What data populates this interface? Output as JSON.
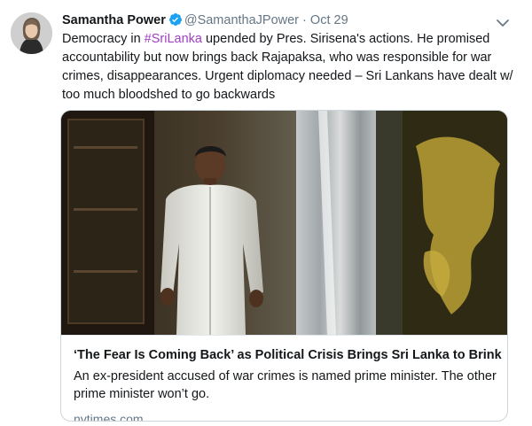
{
  "tweet": {
    "author_name": "Samantha Power",
    "author_handle": "@SamanthaJPower",
    "separator": "·",
    "time": "Oct 29",
    "text_before_hashtag": "Democracy in ",
    "hashtag": "#SriLanka",
    "text_after_hashtag": " upended by Pres. Sirisena's actions. He promised accountability but now brings back Rajapaksa, who was responsible for war crimes, disappearances. Urgent diplomacy needed – Sri Lankans have dealt w/ too much bloodshed to go backwards"
  },
  "card": {
    "title": "‘The Fear Is Coming Back’ as Political Crisis Brings Sri Lanka to Brink",
    "description": "An ex-president accused of war crimes is named prime minister. The other prime minister won’t go.",
    "domain": "nytimes.com"
  },
  "icons": {
    "verified": "verified-badge-icon",
    "caret": "chevron-down-icon"
  },
  "colors": {
    "verified_blue": "#1da1f2",
    "hashtag": "#a23fc4",
    "secondary_text": "#657786",
    "border": "#ccd6dd"
  }
}
